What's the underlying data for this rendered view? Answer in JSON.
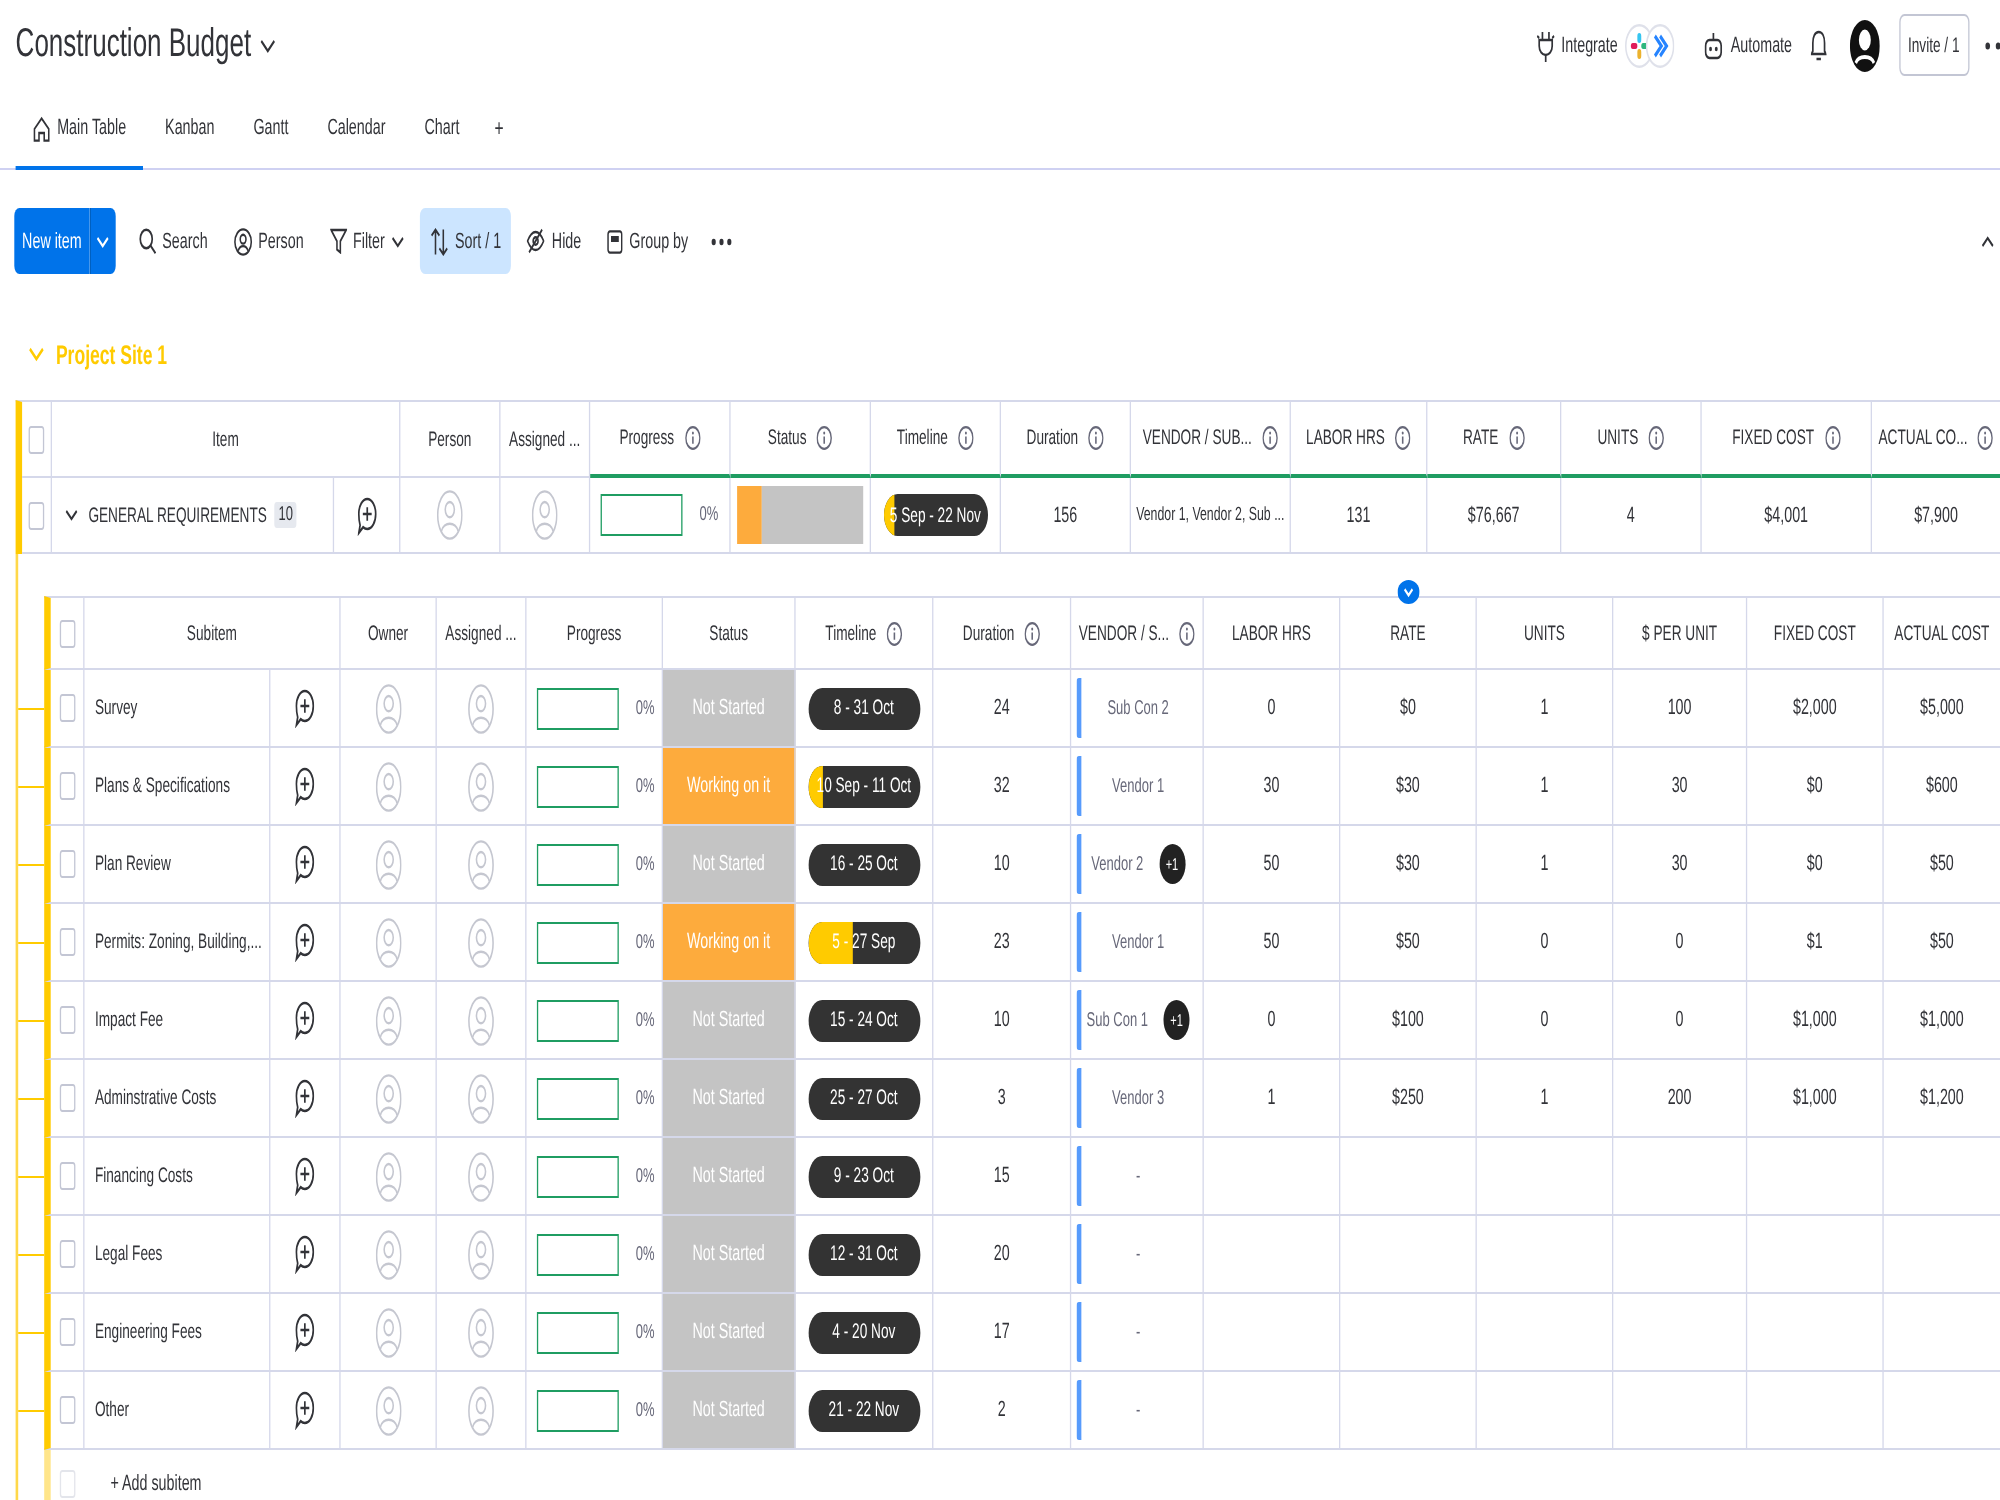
{
  "board": {
    "title": "Construction Budget"
  },
  "top_bar": {
    "integrate": "Integrate",
    "automate": "Automate",
    "invite": "Invite / 1"
  },
  "views": [
    {
      "label": "Main Table",
      "kind": "home",
      "selected": true
    },
    {
      "label": "Kanban",
      "kind": "plain",
      "selected": false
    },
    {
      "label": "Gantt",
      "kind": "plain",
      "selected": false
    },
    {
      "label": "Calendar",
      "kind": "plain",
      "selected": false
    },
    {
      "label": "Chart",
      "kind": "plain",
      "selected": false
    }
  ],
  "add_view": "+",
  "toolbar": {
    "new_item": "New item",
    "actions": [
      {
        "kind": "search",
        "label": "Search",
        "selected": false,
        "dropdown": false
      },
      {
        "kind": "person",
        "label": "Person",
        "selected": false,
        "dropdown": false
      },
      {
        "kind": "filter",
        "label": "Filter",
        "selected": false,
        "dropdown": true
      },
      {
        "kind": "sort",
        "label": "Sort / 1",
        "selected": true,
        "dropdown": false
      },
      {
        "kind": "hide",
        "label": "Hide",
        "selected": false,
        "dropdown": false
      },
      {
        "kind": "group",
        "label": "Group by",
        "selected": false,
        "dropdown": false
      }
    ]
  },
  "group": {
    "title": "Project Site 1",
    "expanded": true,
    "select_all_checked": false,
    "columns": [
      {
        "label": "Item",
        "info": false
      },
      {
        "label": "Person",
        "info": false
      },
      {
        "label": "Assigned ...",
        "info": false
      },
      {
        "label": "Progress",
        "info": true
      },
      {
        "label": "Status",
        "info": true
      },
      {
        "label": "Timeline",
        "info": true
      },
      {
        "label": "Duration",
        "info": true
      },
      {
        "label": "VENDOR / SUB...",
        "info": true
      },
      {
        "label": "LABOR HRS",
        "info": true
      },
      {
        "label": "RATE",
        "info": true
      },
      {
        "label": "UNITS",
        "info": true
      },
      {
        "label": "FIXED COST",
        "info": true
      },
      {
        "label": "ACTUAL CO...",
        "info": true
      }
    ],
    "item": {
      "checked": false,
      "expanded": true,
      "name": "GENERAL REQUIREMENTS",
      "subitem_count": "10",
      "progress": {
        "level": 0,
        "reading": "0%"
      },
      "status_summary": [
        {
          "color": "#fdab3d",
          "level": 0.2
        },
        {
          "color": "#c4c4c4",
          "level": 0.8
        }
      ],
      "timeline": {
        "text": "5 Sep - 22 Nov",
        "level": 0.1
      },
      "duration": "156",
      "vendor": "Vendor 1, Vendor 2, Sub ...",
      "labor_hrs": "131",
      "rate": "$76,667",
      "units": "4",
      "fixed_cost": "$4,001",
      "actual_cost": "$7,900"
    },
    "subitems_header": {
      "checked": false,
      "columns": [
        {
          "label": "Subitem",
          "info": false
        },
        {
          "label": "Owner",
          "info": false
        },
        {
          "label": "Assigned ...",
          "info": false
        },
        {
          "label": "Progress",
          "info": false
        },
        {
          "label": "Status",
          "info": false
        },
        {
          "label": "Timeline",
          "info": true
        },
        {
          "label": "Duration",
          "info": true
        },
        {
          "label": "VENDOR / S...",
          "info": true
        },
        {
          "label": "LABOR HRS",
          "info": false
        },
        {
          "label": "RATE",
          "info": false
        },
        {
          "label": "UNITS",
          "info": false
        },
        {
          "label": "$ PER UNIT",
          "info": false
        },
        {
          "label": "FIXED COST",
          "info": false
        },
        {
          "label": "ACTUAL COST",
          "info": false
        }
      ]
    },
    "subitems": [
      {
        "checked": false,
        "name": "Survey",
        "progress": {
          "level": 0,
          "reading": "0%"
        },
        "status": {
          "label": "Not Started",
          "color": "#c4c4c4"
        },
        "timeline": {
          "text": "8 - 31 Oct",
          "level": 0
        },
        "duration": "24",
        "vendor": "Sub Con 2",
        "labor_hrs": "0",
        "rate": "$0",
        "units": "1",
        "per_unit": "100",
        "fixed_cost": "$2,000",
        "actual_cost": "$5,000"
      },
      {
        "checked": false,
        "name": "Plans & Specifications",
        "progress": {
          "level": 0,
          "reading": "0%"
        },
        "status": {
          "label": "Working on it",
          "color": "#fdab3d"
        },
        "timeline": {
          "text": "10 Sep - 11 Oct",
          "level": 0.13
        },
        "duration": "32",
        "vendor": "Vendor 1",
        "labor_hrs": "30",
        "rate": "$30",
        "units": "1",
        "per_unit": "30",
        "fixed_cost": "$0",
        "actual_cost": "$600"
      },
      {
        "checked": false,
        "name": "Plan Review",
        "progress": {
          "level": 0,
          "reading": "0%"
        },
        "status": {
          "label": "Not Started",
          "color": "#c4c4c4"
        },
        "timeline": {
          "text": "16 - 25 Oct",
          "level": 0
        },
        "duration": "10",
        "vendor": "Vendor 2",
        "vendor_more": "+1",
        "labor_hrs": "50",
        "rate": "$30",
        "units": "1",
        "per_unit": "30",
        "fixed_cost": "$0",
        "actual_cost": "$50"
      },
      {
        "checked": false,
        "name": "Permits: Zoning, Building,...",
        "progress": {
          "level": 0,
          "reading": "0%"
        },
        "status": {
          "label": "Working on it",
          "color": "#fdab3d"
        },
        "timeline": {
          "text": "5 - 27 Sep",
          "level": 0.4
        },
        "duration": "23",
        "vendor": "Vendor 1",
        "labor_hrs": "50",
        "rate": "$50",
        "units": "0",
        "per_unit": "0",
        "fixed_cost": "$1",
        "actual_cost": "$50"
      },
      {
        "checked": false,
        "name": "Impact Fee",
        "progress": {
          "level": 0,
          "reading": "0%"
        },
        "status": {
          "label": "Not Started",
          "color": "#c4c4c4"
        },
        "timeline": {
          "text": "15 - 24 Oct",
          "level": 0
        },
        "duration": "10",
        "vendor": "Sub Con 1",
        "vendor_more": "+1",
        "labor_hrs": "0",
        "rate": "$100",
        "units": "0",
        "per_unit": "0",
        "fixed_cost": "$1,000",
        "actual_cost": "$1,000"
      },
      {
        "checked": false,
        "name": "Adminstrative Costs",
        "progress": {
          "level": 0,
          "reading": "0%"
        },
        "status": {
          "label": "Not Started",
          "color": "#c4c4c4"
        },
        "timeline": {
          "text": "25 - 27 Oct",
          "level": 0
        },
        "duration": "3",
        "vendor": "Vendor 3",
        "labor_hrs": "1",
        "rate": "$250",
        "units": "1",
        "per_unit": "200",
        "fixed_cost": "$1,000",
        "actual_cost": "$1,200"
      },
      {
        "checked": false,
        "name": "Financing Costs",
        "progress": {
          "level": 0,
          "reading": "0%"
        },
        "status": {
          "label": "Not Started",
          "color": "#c4c4c4"
        },
        "timeline": {
          "text": "9 - 23 Oct",
          "level": 0
        },
        "duration": "15",
        "vendor": "-"
      },
      {
        "checked": false,
        "name": "Legal Fees",
        "progress": {
          "level": 0,
          "reading": "0%"
        },
        "status": {
          "label": "Not Started",
          "color": "#c4c4c4"
        },
        "timeline": {
          "text": "12 - 31 Oct",
          "level": 0
        },
        "duration": "20",
        "vendor": "-"
      },
      {
        "checked": false,
        "name": "Engineering Fees",
        "progress": {
          "level": 0,
          "reading": "0%"
        },
        "status": {
          "label": "Not Started",
          "color": "#c4c4c4"
        },
        "timeline": {
          "text": "4 - 20 Nov",
          "level": 0
        },
        "duration": "17",
        "vendor": "-"
      },
      {
        "checked": false,
        "name": "Other",
        "progress": {
          "level": 0,
          "reading": "0%"
        },
        "status": {
          "label": "Not Started",
          "color": "#c4c4c4"
        },
        "timeline": {
          "text": "21 - 22 Nov",
          "level": 0
        },
        "duration": "2",
        "vendor": "-"
      }
    ],
    "add_subitem": {
      "label": "+ Add subitem",
      "checked": false
    }
  }
}
